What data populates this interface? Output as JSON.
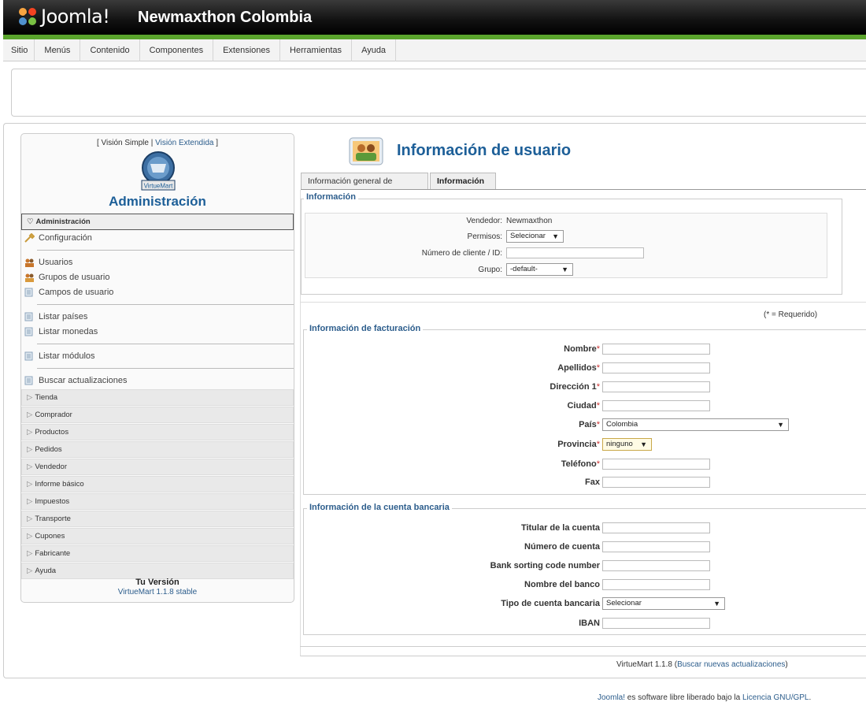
{
  "header": {
    "logo_text": "Joomla!",
    "site_title": "Newmaxthon Colombia"
  },
  "menu": [
    "Sitio",
    "Menús",
    "Contenido",
    "Componentes",
    "Extensiones",
    "Herramientas",
    "Ayuda"
  ],
  "sidebar": {
    "view_simple": "[ Visión Simple",
    "view_sep": " | ",
    "view_extended": "Visión Extendida",
    "view_close": " ]",
    "vm_logo_text": "VirtueMart",
    "admin_title": "Administración",
    "active_section": "Administración",
    "admin_items": [
      {
        "label": "Configuración",
        "icon": "wrench-icon"
      },
      {
        "label": "Usuarios",
        "icon": "users-icon"
      },
      {
        "label": "Grupos de usuario",
        "icon": "user-groups-icon"
      },
      {
        "label": "Campos de usuario",
        "icon": "list-icon"
      },
      {
        "label": "Listar países",
        "icon": "list-icon"
      },
      {
        "label": "Listar monedas",
        "icon": "list-icon"
      },
      {
        "label": "Listar módulos",
        "icon": "list-icon"
      },
      {
        "label": "Buscar actualizaciones",
        "icon": "list-icon"
      }
    ],
    "sections": [
      "Tienda",
      "Comprador",
      "Productos",
      "Pedidos",
      "Vendedor",
      "Informe básico",
      "Impuestos",
      "Transporte",
      "Cupones",
      "Fabricante",
      "Ayuda"
    ],
    "version_title": "Tu Versión",
    "version_text": "VirtueMart 1.1.8 stable"
  },
  "page": {
    "title": "Información de usuario",
    "tabs": [
      "Información general de usuario",
      "Información"
    ],
    "info_legend": "Información",
    "vendor_label": "Vendedor:",
    "vendor_value": "Newmaxthon",
    "perms_label": "Permisos:",
    "perms_value": "Selecionar",
    "client_label": "Número de cliente / ID:",
    "client_value": "",
    "group_label": "Grupo:",
    "group_value": "-default-",
    "required_note": "(* = Requerido)",
    "billing_legend": "Información de facturación",
    "billing_fields": [
      {
        "label": "Nombre",
        "req": "*",
        "value": ""
      },
      {
        "label": "Apellidos",
        "req": "*",
        "value": ""
      },
      {
        "label": "Dirección 1",
        "req": "*",
        "value": ""
      },
      {
        "label": "Ciudad",
        "req": "*",
        "value": ""
      },
      {
        "label": "País",
        "req": "*",
        "value": "Colombia"
      },
      {
        "label": "Provincia",
        "req": "*",
        "value": "ninguno"
      },
      {
        "label": "Teléfono",
        "req": "*",
        "value": ""
      },
      {
        "label": "Fax",
        "req": "",
        "value": ""
      }
    ],
    "bank_legend": "Información de la cuenta bancaria",
    "bank_fields": [
      {
        "label": "Titular de la cuenta",
        "value": ""
      },
      {
        "label": "Número de cuenta",
        "value": ""
      },
      {
        "label": "Bank sorting code number",
        "value": ""
      },
      {
        "label": "Nombre del banco",
        "value": ""
      },
      {
        "label": "Tipo de cuenta bancaria",
        "value": "Selecionar"
      },
      {
        "label": "IBAN",
        "value": ""
      }
    ]
  },
  "footer": {
    "vm_version": "VirtueMart 1.1.8",
    "vm_link_open": " (",
    "vm_link": "Buscar nuevas actualizaciones",
    "vm_link_close": ")",
    "joomla_link": "Joomla!",
    "joomla_text": " es software libre liberado bajo la ",
    "license_link": "Licencia GNU/GPL",
    "joomla_end": "."
  },
  "colors": {
    "accent_blue": "#1d5f98",
    "link_blue": "#2c5d8c",
    "header_green": "#5aa42c",
    "required_red": "#cc3333"
  }
}
